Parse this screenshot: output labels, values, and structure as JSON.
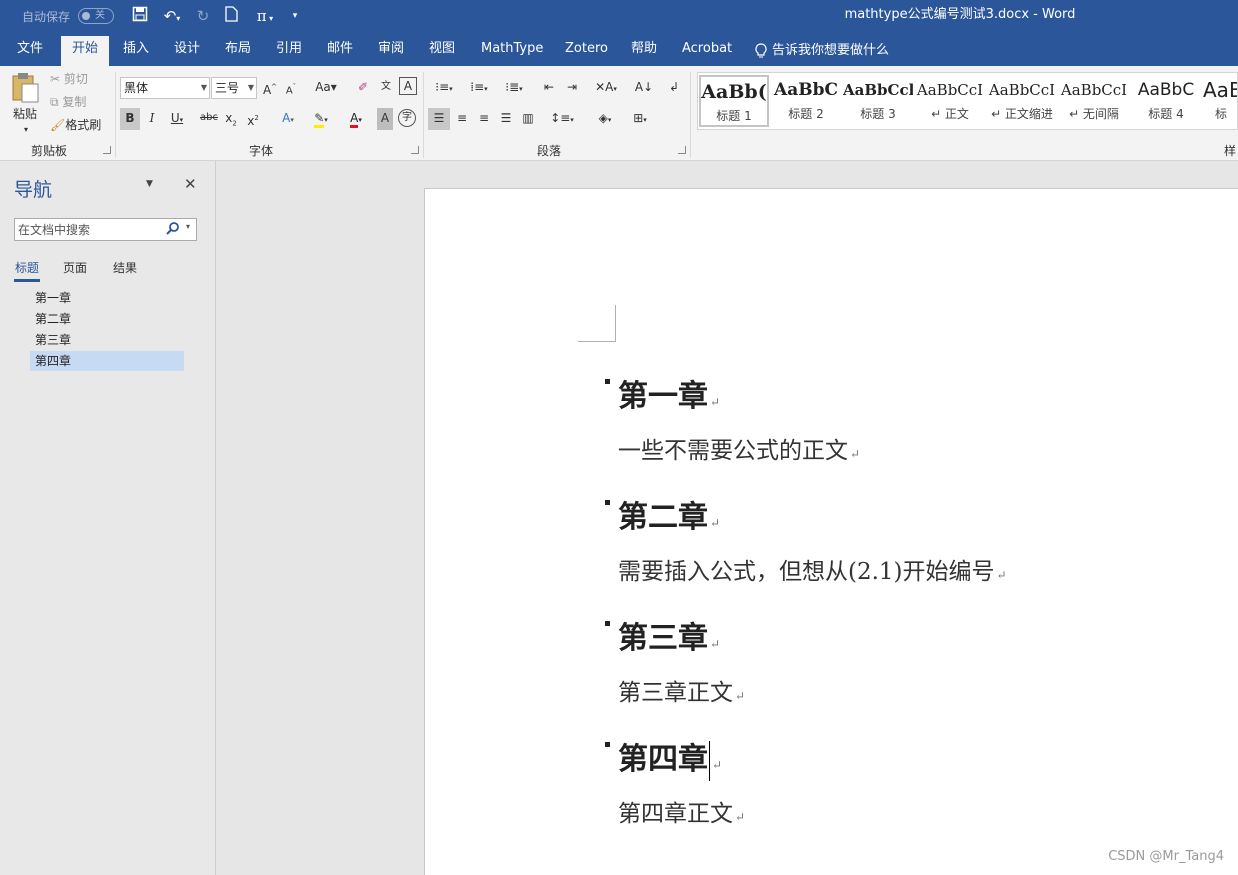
{
  "titlebar": {
    "autosave_label": "自动保存",
    "autosave_state": "关",
    "doc_title": "mathtype公式编号测试3.docx  -  Word"
  },
  "tabs": [
    "文件",
    "开始",
    "插入",
    "设计",
    "布局",
    "引用",
    "邮件",
    "审阅",
    "视图",
    "MathType",
    "Zotero",
    "帮助",
    "Acrobat"
  ],
  "tell_me": "告诉我你想要做什么",
  "ribbon": {
    "clipboard": {
      "paste": "粘贴",
      "cut": "剪切",
      "copy": "复制",
      "format_painter": "格式刷",
      "label": "剪贴板"
    },
    "font": {
      "font_name": "黑体",
      "font_size": "三号",
      "label": "字体"
    },
    "paragraph": {
      "label": "段落"
    },
    "styles": {
      "label": "样",
      "items": [
        {
          "sample": "AaBb(",
          "name": "标题 1"
        },
        {
          "sample": "AaBbC",
          "name": "标题 2"
        },
        {
          "sample": "AaBbCcl",
          "name": "标题 3"
        },
        {
          "sample": "AaBbCcI",
          "name": "↵ 正文"
        },
        {
          "sample": "AaBbCcI",
          "name": "↵ 正文缩进"
        },
        {
          "sample": "AaBbCcI",
          "name": "↵ 无间隔"
        },
        {
          "sample": "AaBbC",
          "name": "标题 4"
        },
        {
          "sample": "AaB",
          "name": "标"
        }
      ]
    }
  },
  "nav": {
    "title": "导航",
    "search_placeholder": "在文档中搜索",
    "tabs": [
      "标题",
      "页面",
      "结果"
    ],
    "headings": [
      "第一章",
      "第二章",
      "第三章",
      "第四章"
    ]
  },
  "document": {
    "blocks": [
      {
        "heading": "第一章",
        "text": "一些不需要公式的正文"
      },
      {
        "heading": "第二章",
        "text": "需要插入公式，但想从(2.1)开始编号"
      },
      {
        "heading": "第三章",
        "text": "第三章正文"
      },
      {
        "heading": "第四章",
        "text": "第四章正文"
      }
    ],
    "paragraph_mark": "↵"
  },
  "watermark": "CSDN @Mr_Tang4"
}
